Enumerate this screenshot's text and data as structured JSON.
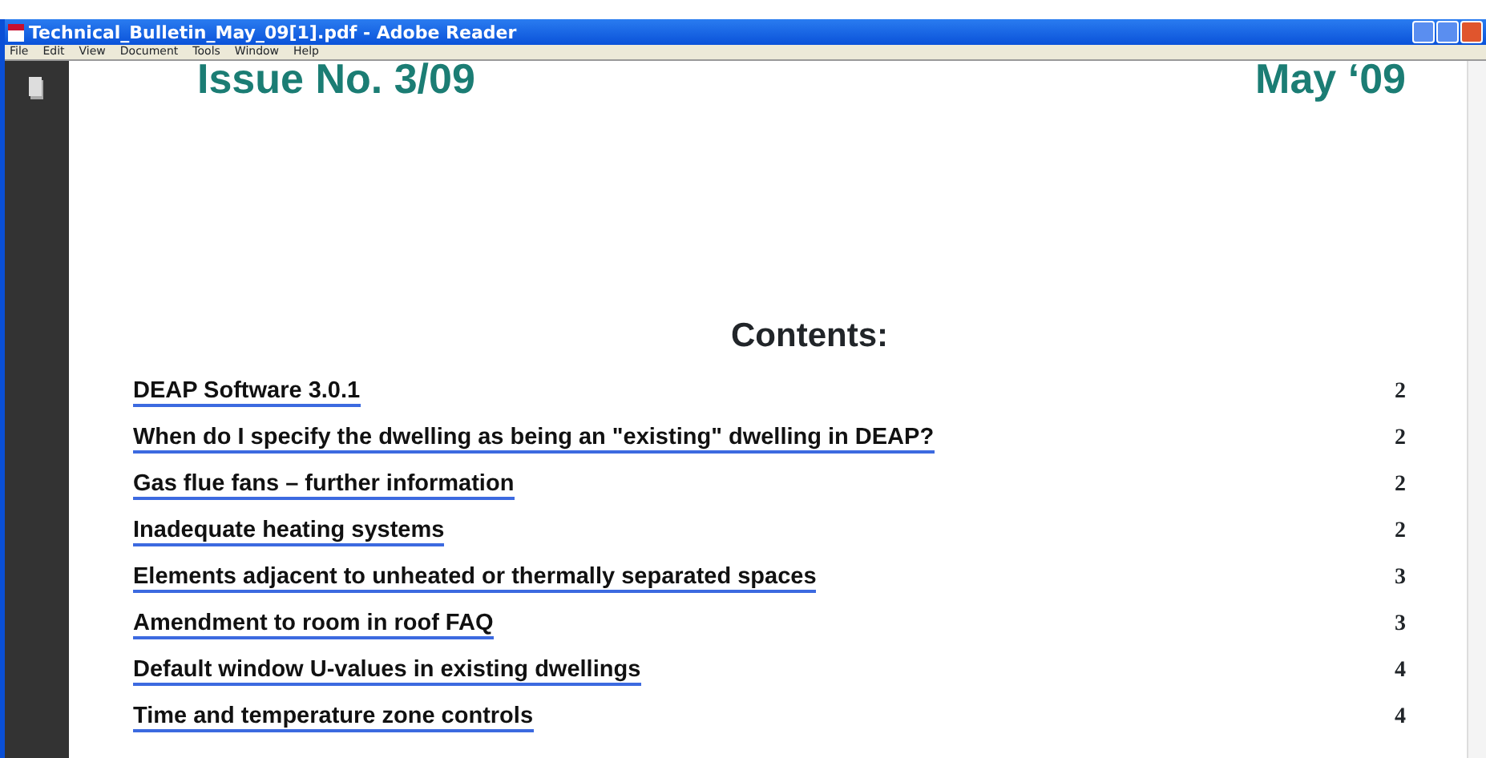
{
  "window": {
    "title": "Technical_Bulletin_May_09[1].pdf - Adobe Reader"
  },
  "menu": [
    "File",
    "Edit",
    "View",
    "Document",
    "Tools",
    "Window",
    "Help"
  ],
  "document": {
    "issue": "Issue No. 3/09",
    "date": "May ‘09",
    "contents_heading": "Contents:",
    "entries": [
      {
        "title": "DEAP Software 3.0.1",
        "page": "2"
      },
      {
        "title": "When do I specify the dwelling as being an \"existing\" dwelling in DEAP?",
        "page": "2"
      },
      {
        "title": "Gas flue fans – further information",
        "page": "2"
      },
      {
        "title": "Inadequate heating systems",
        "page": "2"
      },
      {
        "title": "Elements adjacent to unheated or thermally separated spaces",
        "page": "3"
      },
      {
        "title": "Amendment to room in roof FAQ",
        "page": "3"
      },
      {
        "title": "Default window U-values in existing dwellings",
        "page": "4"
      },
      {
        "title": "Time and temperature zone controls",
        "page": "4"
      }
    ]
  }
}
